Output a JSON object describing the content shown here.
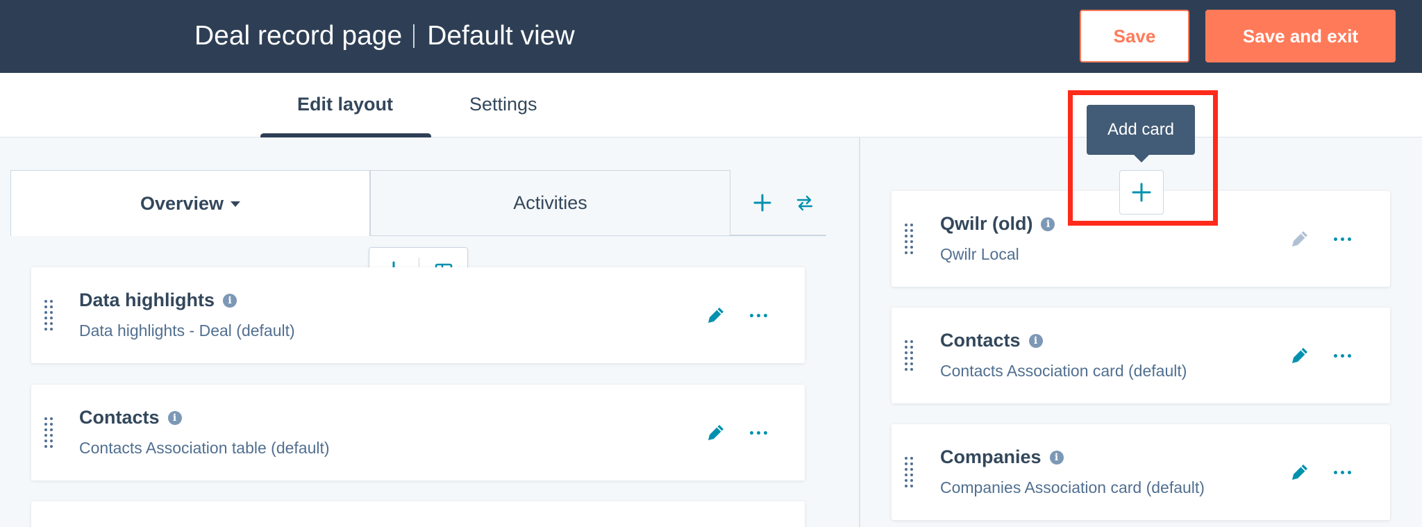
{
  "header": {
    "title_primary": "Deal record page",
    "title_secondary": "Default view",
    "save_label": "Save",
    "save_exit_label": "Save and exit"
  },
  "tabs": {
    "edit_layout": "Edit layout",
    "settings": "Settings"
  },
  "left_tabs": {
    "overview": "Overview",
    "activities": "Activities"
  },
  "tooltip": {
    "add_card": "Add card"
  },
  "left_cards": [
    {
      "title": "Data highlights",
      "subtitle": "Data highlights - Deal (default)"
    },
    {
      "title": "Contacts",
      "subtitle": "Contacts Association table (default)"
    }
  ],
  "right_cards": [
    {
      "title": "Qwilr (old)",
      "subtitle": "Qwilr Local"
    },
    {
      "title": "Contacts",
      "subtitle": "Contacts Association card (default)"
    },
    {
      "title": "Companies",
      "subtitle": "Companies Association card (default)"
    }
  ],
  "colors": {
    "header_bg": "#2e3f55",
    "accent_orange": "#ff7a59",
    "accent_teal": "#0091ae",
    "highlight_red": "#ff2a1a"
  }
}
